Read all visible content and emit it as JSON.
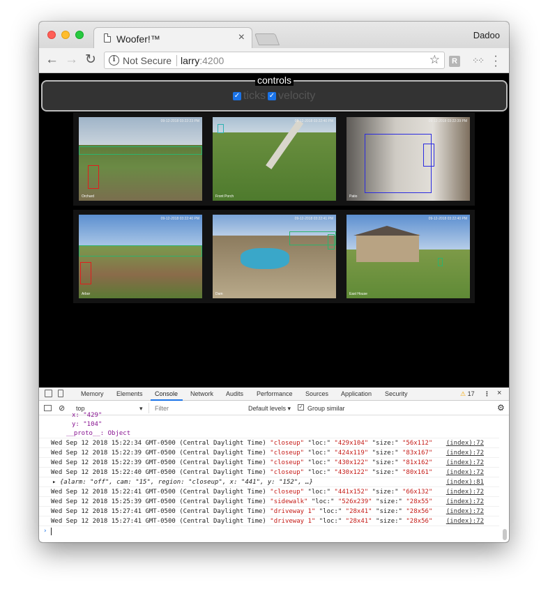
{
  "browser": {
    "tab_title": "Woofer!™",
    "tab_close": "×",
    "profile_name": "Dadoo",
    "security_label": "Not Secure",
    "url_host": "larry",
    "url_port": ":4200",
    "extension_badge": "R"
  },
  "page": {
    "controls_legend": "controls",
    "ticks_label": "ticks",
    "velocity_label": "velocity",
    "ticks_checked": true,
    "velocity_checked": true,
    "cameras": [
      {
        "label": "Orchard",
        "timestamp": "09-12-2018 03:22:23 PM"
      },
      {
        "label": "Front Porch",
        "timestamp": "09-12-2018 03:22:40 PM"
      },
      {
        "label": "Patio",
        "timestamp": "09-12-2018 03:22:39 PM"
      },
      {
        "label": "Arbor",
        "timestamp": "09-12-2018 03:22:40 PM"
      },
      {
        "label": "Dam",
        "timestamp": "09-12-2018 03:22:41 PM"
      },
      {
        "label": "East House",
        "timestamp": "09-12-2018 03:22:40 PM"
      }
    ]
  },
  "devtools": {
    "tabs": [
      "Memory",
      "Elements",
      "Console",
      "Network",
      "Audits",
      "Performance",
      "Sources",
      "Application",
      "Security"
    ],
    "active_tab": "Console",
    "warning_count": "17",
    "context": "top",
    "filter_placeholder": "Filter",
    "levels": "Default levels ▾",
    "group_similar": "Group similar",
    "obj_x": "x: \"429\"",
    "obj_y": "y: \"104\"",
    "obj_proto": "__proto__: Object",
    "logs": [
      {
        "prefix": "Wed Sep 12 2018 15:22:34 GMT-0500 (Central Daylight Time) ",
        "region": "\"closeup\"",
        "loc_k": " \"loc:\" ",
        "loc": "\"429x104\"",
        "size_k": " \"size:\" ",
        "size": "\"56x112\"",
        "src": "(index):72"
      },
      {
        "prefix": "Wed Sep 12 2018 15:22:39 GMT-0500 (Central Daylight Time) ",
        "region": "\"closeup\"",
        "loc_k": " \"loc:\" ",
        "loc": "\"424x119\"",
        "size_k": " \"size:\" ",
        "size": "\"83x167\"",
        "src": "(index):72"
      },
      {
        "prefix": "Wed Sep 12 2018 15:22:39 GMT-0500 (Central Daylight Time) ",
        "region": "\"closeup\"",
        "loc_k": " \"loc:\" ",
        "loc": "\"430x122\"",
        "size_k": " \"size:\" ",
        "size": "\"81x162\"",
        "src": "(index):72"
      },
      {
        "prefix": "Wed Sep 12 2018 15:22:40 GMT-0500 (Central Daylight Time) ",
        "region": "\"closeup\"",
        "loc_k": " \"loc:\" ",
        "loc": "\"430x122\"",
        "size_k": " \"size:\" ",
        "size": "\"80x161\"",
        "src": "(index):72"
      }
    ],
    "alarm_obj": "▸ {alarm: \"off\", cam: \"15\", region: \"closeup\", x: \"441\", y: \"152\", …}",
    "alarm_src": "(index):81",
    "logs2": [
      {
        "prefix": "Wed Sep 12 2018 15:22:41 GMT-0500 (Central Daylight Time) ",
        "region": "\"closeup\"",
        "loc_k": " \"loc:\" ",
        "loc": "\"441x152\"",
        "size_k": " \"size:\" ",
        "size": "\"66x132\"",
        "src": "(index):72"
      },
      {
        "prefix": "Wed Sep 12 2018 15:25:39 GMT-0500 (Central Daylight Time) ",
        "region": "\"sidewalk\"",
        "loc_k": " \"loc:\" ",
        "loc": "\"526x239\"",
        "size_k": " \"size:\" ",
        "size": "\"28x55\"",
        "src": "(index):72"
      },
      {
        "prefix": "Wed Sep 12 2018 15:27:41 GMT-0500 (Central Daylight Time) ",
        "region": "\"driveway 1\"",
        "loc_k": " \"loc:\" ",
        "loc": "\"28x41\"",
        "size_k": " \"size:\" ",
        "size": "\"28x56\"",
        "src": "(index):72"
      },
      {
        "prefix": "Wed Sep 12 2018 15:27:41 GMT-0500 (Central Daylight Time) ",
        "region": "\"driveway 1\"",
        "loc_k": " \"loc:\" ",
        "loc": "\"28x41\"",
        "size_k": " \"size:\" ",
        "size": "\"28x56\"",
        "src": "(index):72"
      }
    ],
    "prompt": "›"
  }
}
